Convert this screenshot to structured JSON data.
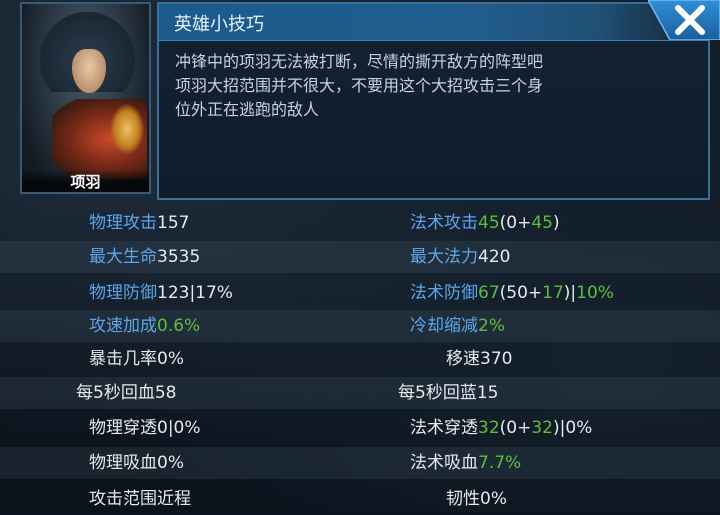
{
  "hero": {
    "name": "项羽"
  },
  "tips": {
    "title": "英雄小技巧",
    "lines": [
      "冲锋中的项羽无法被打断，尽情的撕开敌方的阵型吧",
      "项羽大招范围并不很大，不要用这个大招攻击三个身",
      "位外正在逃跑的敌人"
    ]
  },
  "icons": {
    "close": "close-x-icon"
  },
  "colors": {
    "label_blue": "#5aa6ec",
    "bonus_green": "#5cbf3c",
    "panel_border": "#3c6f97"
  },
  "stats": {
    "phys_attack": {
      "label": "物理攻击",
      "value": "157"
    },
    "magic_attack": {
      "label": "法术攻击",
      "base": "45",
      "open": "(0+",
      "bonus": "45",
      "close": ")"
    },
    "max_hp": {
      "label": "最大生命",
      "value": "3535"
    },
    "max_mana": {
      "label": "最大法力",
      "value": "420"
    },
    "phys_def": {
      "label": "物理防御",
      "value": "123|17%"
    },
    "magic_def": {
      "label": "法术防御",
      "base": "67",
      "open": "(50+",
      "bonus": "17",
      "close": ")|",
      "pct": "10%"
    },
    "attack_speed": {
      "label": "攻速加成",
      "value": "0.6%"
    },
    "cdr": {
      "label": "冷却缩减",
      "value": "2%"
    },
    "crit": {
      "label": "暴击几率",
      "value": "0%"
    },
    "move_speed": {
      "label": "移速",
      "value": "370"
    },
    "hp_regen": {
      "label": "每5秒回血",
      "value": "58"
    },
    "mana_regen": {
      "label": "每5秒回蓝",
      "value": "15"
    },
    "phys_pen": {
      "label": "物理穿透",
      "value": "0|0%"
    },
    "magic_pen": {
      "label": "法术穿透",
      "base": "32",
      "open": "(0+",
      "bonus": "32",
      "close": ")|0%"
    },
    "phys_lifesteal": {
      "label": "物理吸血",
      "value": "0%"
    },
    "magic_lifesteal": {
      "label": "法术吸血",
      "value": "7.7%"
    },
    "attack_range": {
      "label": "攻击范围",
      "value": "近程"
    },
    "tenacity": {
      "label": "韧性",
      "value": "0%"
    }
  }
}
